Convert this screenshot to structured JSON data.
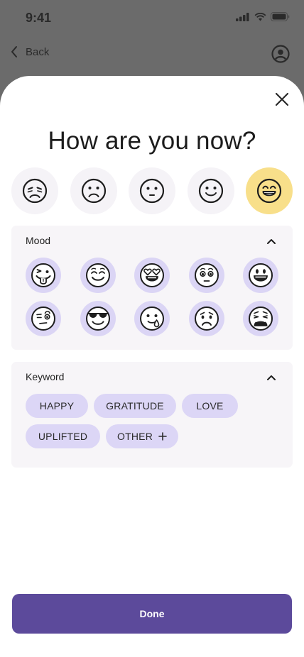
{
  "status_bar": {
    "time": "9:41"
  },
  "nav": {
    "back_label": "Back"
  },
  "sheet": {
    "title": "How are you now?",
    "faces": [
      "very-sad-face-icon",
      "sad-face-icon",
      "neutral-face-icon",
      "smiling-face-icon",
      "grinning-face-icon"
    ],
    "selected_face_index": 4
  },
  "mood": {
    "label": "Mood",
    "emojis": [
      "tongue-out-face-icon",
      "blushing-smile-face-icon",
      "heart-eyes-face-icon",
      "pleading-face-icon",
      "big-smile-face-icon",
      "raised-eyebrow-face-icon",
      "sunglasses-face-icon",
      "tear-smile-face-icon",
      "worried-face-icon",
      "weary-face-icon"
    ]
  },
  "keyword": {
    "label": "Keyword",
    "chips": [
      "HAPPY",
      "GRATITUDE",
      "LOVE",
      "UPLIFTED",
      "OTHER"
    ],
    "other_icon": "plus-icon"
  },
  "actions": {
    "done_label": "Done"
  },
  "colors": {
    "accent": "#5c4a9b",
    "chip": "#dcd6f6",
    "selected_face": "#f8df8a",
    "panel": "#f7f5f8"
  }
}
